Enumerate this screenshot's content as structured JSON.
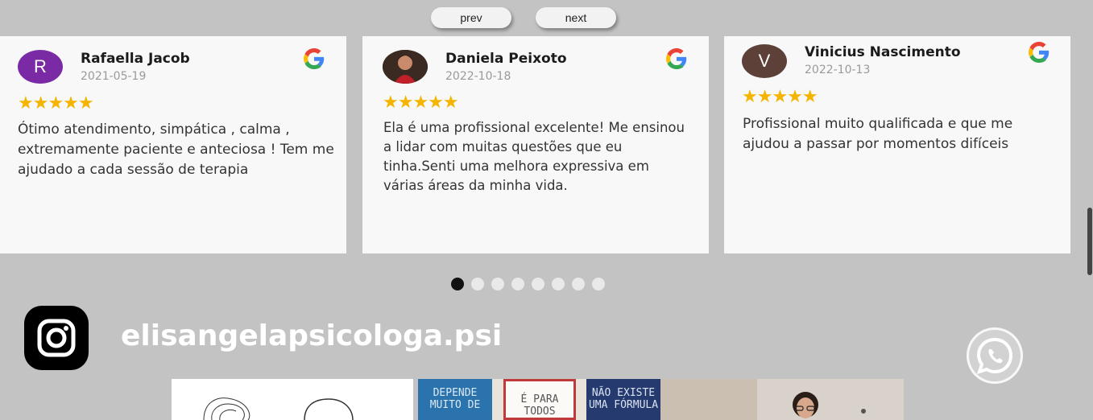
{
  "nav": {
    "prev_label": "prev",
    "next_label": "next"
  },
  "reviews": [
    {
      "name": "Rafaella Jacob",
      "date": "2021-05-19",
      "avatar_letter": "R",
      "avatar_color": "#7b2aa6",
      "rating": 5,
      "text": "Ótimo atendimento, simpática , calma , extremamente paciente e anteciosa ! Tem me ajudado a cada sessão de terapia"
    },
    {
      "name": "Daniela Peixoto",
      "date": "2022-10-18",
      "avatar_letter": "",
      "avatar_color": "#5a3a2a",
      "rating": 5,
      "text": "Ela é uma profissional excelente! Me ensinou a lidar com muitas questões que eu tinha.Senti uma melhora expressiva em várias áreas da minha vida."
    },
    {
      "name": "Vinicius Nascimento",
      "date": "2022-10-13",
      "avatar_letter": "V",
      "avatar_color": "#5d4037",
      "rating": 5,
      "text": "Profissional muito qualificada e que me ajudou a passar por momentos difíceis"
    }
  ],
  "carousel": {
    "total_dots": 8,
    "active_index": 0
  },
  "instagram": {
    "handle": "elisangelapsicologa.psi"
  },
  "gallery": {
    "book_1": "DEPENDE MUITO DE",
    "book_2": "É PARA TODOS",
    "book_3": "NÃO EXISTE UMA FÓRMULA"
  },
  "colors": {
    "background": "#c3c3c3",
    "star": "#f4b400",
    "card": "#f7f8f7"
  }
}
